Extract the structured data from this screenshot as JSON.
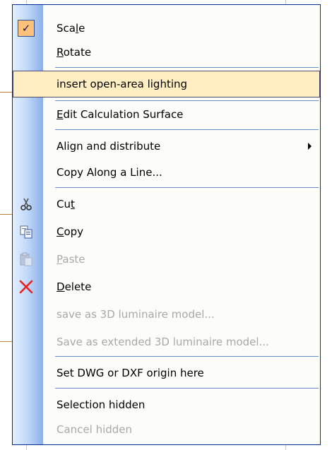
{
  "menu": {
    "items": [
      {
        "pre": "Sca",
        "mn": "l",
        "post": "e",
        "disabled": false
      },
      {
        "pre": "",
        "mn": "R",
        "post": "otate",
        "disabled": false
      },
      {
        "pre": "insert open-area lighting",
        "mn": "",
        "post": "",
        "disabled": false
      },
      {
        "pre": "",
        "mn": "E",
        "post": "dit Calculation Surface",
        "disabled": false
      },
      {
        "pre": "Align and distribute",
        "mn": "",
        "post": "",
        "disabled": false
      },
      {
        "pre": "Copy Along a Line...",
        "mn": "",
        "post": "",
        "disabled": false
      },
      {
        "pre": "Cu",
        "mn": "t",
        "post": "",
        "disabled": false
      },
      {
        "pre": "",
        "mn": "C",
        "post": "opy",
        "disabled": false
      },
      {
        "pre": "",
        "mn": "P",
        "post": "aste",
        "disabled": true
      },
      {
        "pre": "",
        "mn": "D",
        "post": "elete",
        "disabled": false
      },
      {
        "pre": "save as 3D luminaire model...",
        "mn": "",
        "post": "",
        "disabled": true
      },
      {
        "pre": "Save as extended 3D luminaire model...",
        "mn": "",
        "post": "",
        "disabled": true
      },
      {
        "pre": "Set DWG or DXF origin here",
        "mn": "",
        "post": "",
        "disabled": false
      },
      {
        "pre": "Selection hidden",
        "mn": "",
        "post": "",
        "disabled": false
      },
      {
        "pre": "Cancel hidden",
        "mn": "",
        "post": "",
        "disabled": true
      }
    ],
    "icons": {
      "scale": "checkmark-icon",
      "cut": "scissors-icon",
      "copy": "copy-icon",
      "paste": "paste-icon",
      "delete": "delete-x-icon",
      "align": "submenu-arrow-icon"
    },
    "colors": {
      "highlight_bg": "#ffeec2",
      "highlight_border": "#4b4b6f",
      "gutter": "#8cb0ea",
      "border": "#002d96",
      "separator": "#6a8ccb",
      "disabled_text": "#a9a9a9",
      "delete_icon": "#e8201e"
    }
  }
}
